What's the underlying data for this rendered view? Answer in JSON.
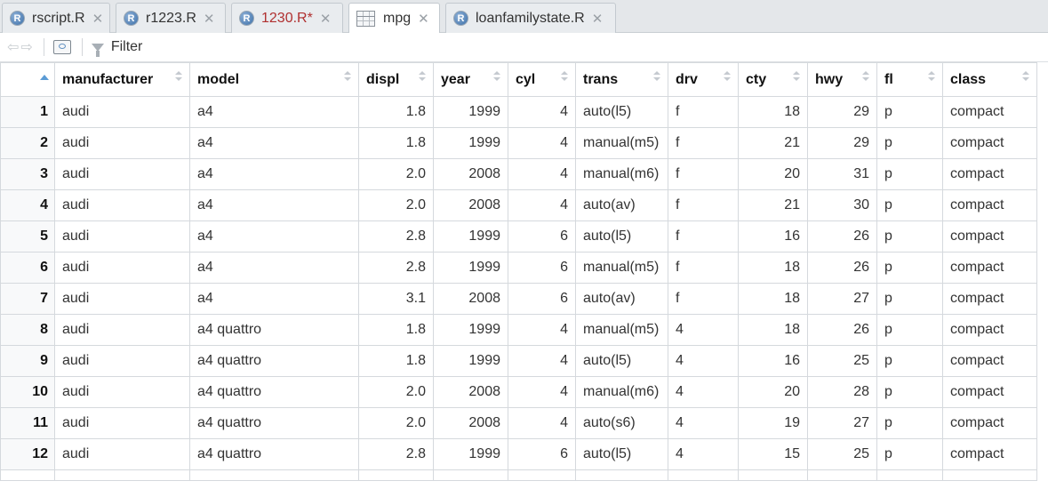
{
  "tabs": [
    {
      "label": "rscript.R",
      "icon": "r-file-icon",
      "modified": false,
      "active": false
    },
    {
      "label": "r1223.R",
      "icon": "r-file-icon",
      "modified": false,
      "active": false
    },
    {
      "label": "1230.R*",
      "icon": "r-file-icon",
      "modified": true,
      "active": false
    },
    {
      "label": "mpg",
      "icon": "data-grid-icon",
      "modified": false,
      "active": true
    },
    {
      "label": "loanfamilystate.R",
      "icon": "r-file-icon",
      "modified": false,
      "active": false
    }
  ],
  "toolbar": {
    "back_icon": "back-arrow-icon",
    "forward_icon": "forward-arrow-icon",
    "popout_icon": "popout-window-icon",
    "filter_label": "Filter"
  },
  "columns": [
    "manufacturer",
    "model",
    "displ",
    "year",
    "cyl",
    "trans",
    "drv",
    "cty",
    "hwy",
    "fl",
    "class"
  ],
  "rows": [
    {
      "n": "1",
      "cells": [
        "audi",
        "a4",
        "1.8",
        "1999",
        "4",
        "auto(l5)",
        "f",
        "18",
        "29",
        "p",
        "compact"
      ]
    },
    {
      "n": "2",
      "cells": [
        "audi",
        "a4",
        "1.8",
        "1999",
        "4",
        "manual(m5)",
        "f",
        "21",
        "29",
        "p",
        "compact"
      ]
    },
    {
      "n": "3",
      "cells": [
        "audi",
        "a4",
        "2.0",
        "2008",
        "4",
        "manual(m6)",
        "f",
        "20",
        "31",
        "p",
        "compact"
      ]
    },
    {
      "n": "4",
      "cells": [
        "audi",
        "a4",
        "2.0",
        "2008",
        "4",
        "auto(av)",
        "f",
        "21",
        "30",
        "p",
        "compact"
      ]
    },
    {
      "n": "5",
      "cells": [
        "audi",
        "a4",
        "2.8",
        "1999",
        "6",
        "auto(l5)",
        "f",
        "16",
        "26",
        "p",
        "compact"
      ]
    },
    {
      "n": "6",
      "cells": [
        "audi",
        "a4",
        "2.8",
        "1999",
        "6",
        "manual(m5)",
        "f",
        "18",
        "26",
        "p",
        "compact"
      ]
    },
    {
      "n": "7",
      "cells": [
        "audi",
        "a4",
        "3.1",
        "2008",
        "6",
        "auto(av)",
        "f",
        "18",
        "27",
        "p",
        "compact"
      ]
    },
    {
      "n": "8",
      "cells": [
        "audi",
        "a4 quattro",
        "1.8",
        "1999",
        "4",
        "manual(m5)",
        "4",
        "18",
        "26",
        "p",
        "compact"
      ]
    },
    {
      "n": "9",
      "cells": [
        "audi",
        "a4 quattro",
        "1.8",
        "1999",
        "4",
        "auto(l5)",
        "4",
        "16",
        "25",
        "p",
        "compact"
      ]
    },
    {
      "n": "10",
      "cells": [
        "audi",
        "a4 quattro",
        "2.0",
        "2008",
        "4",
        "manual(m6)",
        "4",
        "20",
        "28",
        "p",
        "compact"
      ]
    },
    {
      "n": "11",
      "cells": [
        "audi",
        "a4 quattro",
        "2.0",
        "2008",
        "4",
        "auto(s6)",
        "4",
        "19",
        "27",
        "p",
        "compact"
      ]
    },
    {
      "n": "12",
      "cells": [
        "audi",
        "a4 quattro",
        "2.8",
        "1999",
        "6",
        "auto(l5)",
        "4",
        "15",
        "25",
        "p",
        "compact"
      ]
    }
  ],
  "colors": {
    "accent": "#5b9bd5",
    "modified_tab": "#b03030"
  }
}
